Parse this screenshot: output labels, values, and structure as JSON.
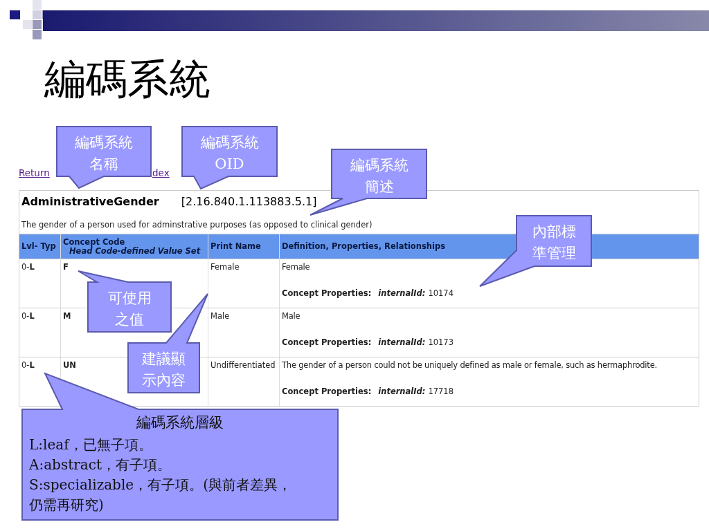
{
  "slide": {
    "title": "編碼系統"
  },
  "page": {
    "link_parts": [
      "Return",
      "dex"
    ],
    "code_system": {
      "name": "AdministrativeGender",
      "oid": "[2.16.840.1.113883.5.1]",
      "description": "The gender of a person used for adminstrative purposes (as opposed to clinical gender)"
    },
    "table": {
      "columns": [
        {
          "label": "Lvl- Typ"
        },
        {
          "label": "Concept Code",
          "sublabel": "Head Code-defined Value Set"
        },
        {
          "label": "Print Name"
        },
        {
          "label": "Definition, Properties, Relationships"
        }
      ],
      "rows": [
        {
          "lvl_typ": "0-**L**",
          "code": "F",
          "print_name": "Female",
          "definition": "Female",
          "property_label": "Concept Properties:",
          "property_name": "internalId:",
          "property_value": "10174"
        },
        {
          "lvl_typ": "0-**L**",
          "code": "M",
          "print_name": "Male",
          "definition": "Male",
          "property_label": "Concept Properties:",
          "property_name": "internalId:",
          "property_value": "10173"
        },
        {
          "lvl_typ": "0-**L**",
          "code": "UN",
          "print_name": "Undifferentiated",
          "definition": "The gender of a person could not be uniquely defined as male or female, such as hermaphrodite.",
          "property_label": "Concept Properties:",
          "property_name": "internalId:",
          "property_value": "17718"
        }
      ]
    }
  },
  "callouts": [
    {
      "kind": "label",
      "lines": [
        "編碼系統",
        "名稱"
      ]
    },
    {
      "kind": "label",
      "lines": [
        "編碼系統",
        "OID"
      ]
    },
    {
      "kind": "label",
      "lines": [
        "編碼系統",
        "簡述"
      ]
    },
    {
      "kind": "label",
      "lines": [
        "內部標",
        "準管理"
      ]
    },
    {
      "kind": "label",
      "lines": [
        "可使用",
        "之值"
      ]
    },
    {
      "kind": "label",
      "lines": [
        "建議顯",
        "示內容"
      ]
    },
    {
      "kind": "note",
      "lines": [
        "編碼系統層級",
        "L:leaf，已無子項。",
        "A:abstract，有子項。",
        "S:specializable，有子項。(與前者差異，",
        "仍需再研究)"
      ]
    }
  ]
}
